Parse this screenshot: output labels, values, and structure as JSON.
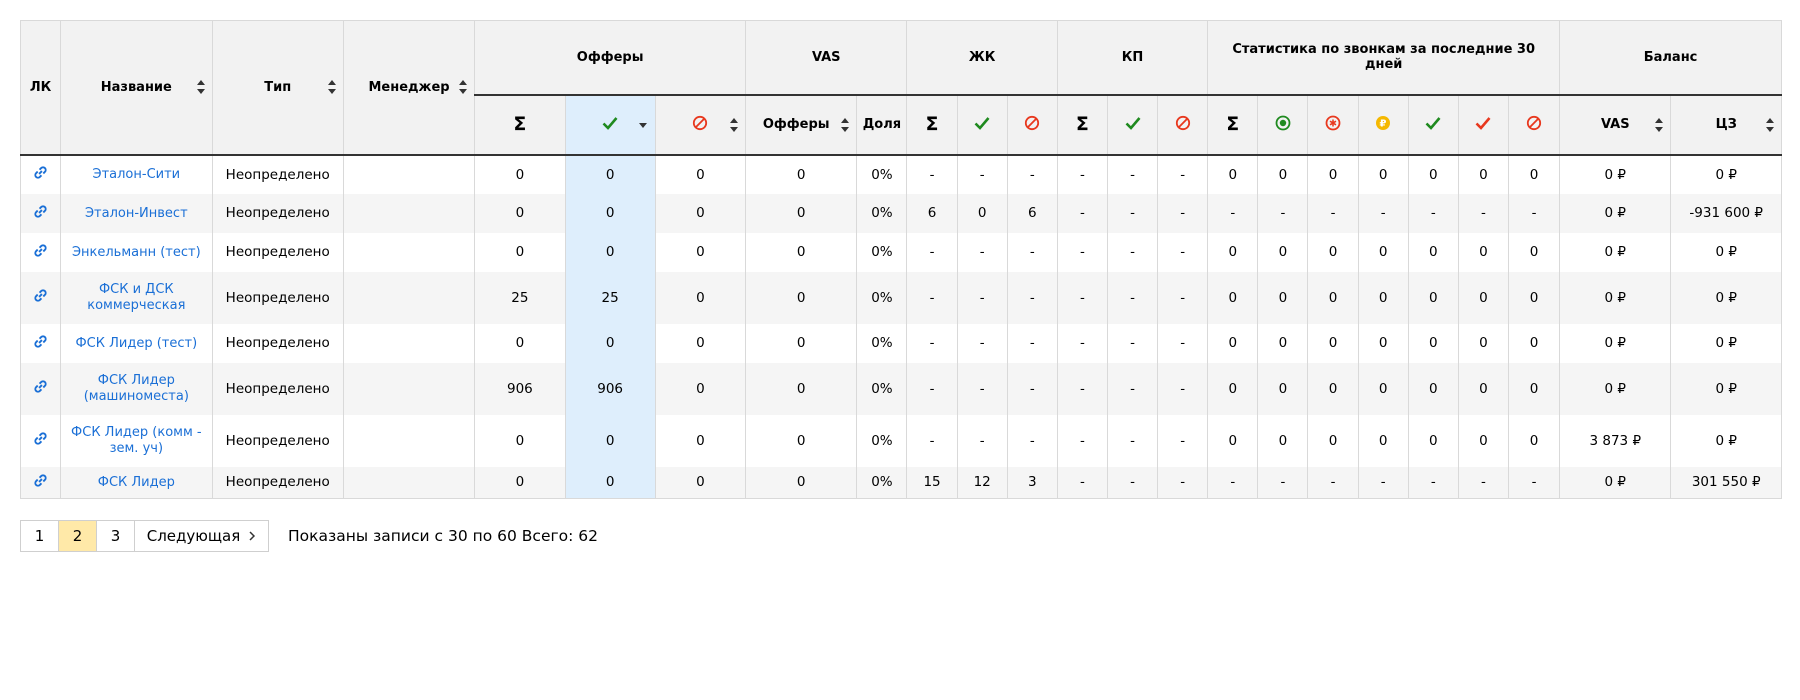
{
  "header": {
    "lk": "ЛК",
    "name": "Название",
    "type": "Тип",
    "manager": "Менеджер",
    "offers": "Офферы",
    "vas": "VAS",
    "zhk": "ЖК",
    "kp": "КП",
    "calls": "Статистика по звонкам за последние 30 дней",
    "balance": "Баланс",
    "sigma": "Σ",
    "vas_offers": "Офферы",
    "vas_share": "Доля",
    "bal_vas": "VAS",
    "bal_cz": "ЦЗ"
  },
  "colors": {
    "check": "#1f8a1f",
    "ban": "#e8381e",
    "link": "#1a6fd6",
    "selected_column": "#deeefc",
    "current_page": "#ffe9a8",
    "call_green": "#1f8a1f",
    "call_red": "#e8381e",
    "call_yellow": "#f5b800"
  },
  "icons": {
    "offers": [
      "sigma-icon",
      "check-icon",
      "ban-icon"
    ],
    "zhk": [
      "sigma-icon",
      "check-icon",
      "ban-icon"
    ],
    "kp": [
      "sigma-icon",
      "check-icon",
      "ban-icon"
    ],
    "calls": [
      "sigma-icon",
      "plus-circle-icon",
      "asterisk-circle-icon",
      "ruble-circle-icon",
      "check-icon",
      "check-red-icon",
      "ban-icon"
    ],
    "row_link": "link-icon"
  },
  "rows": [
    {
      "name": "Эталон-Сити",
      "type": "Неопределено",
      "manager": "",
      "offers": [
        "0",
        "0",
        "0"
      ],
      "vas": [
        "0",
        "0%"
      ],
      "zhk": [
        "-",
        "-",
        "-"
      ],
      "kp": [
        "-",
        "-",
        "-"
      ],
      "calls": [
        "0",
        "0",
        "0",
        "0",
        "0",
        "0",
        "0"
      ],
      "balance": [
        "0 ₽",
        "0 ₽"
      ]
    },
    {
      "name": "Эталон-Инвест",
      "type": "Неопределено",
      "manager": "",
      "offers": [
        "0",
        "0",
        "0"
      ],
      "vas": [
        "0",
        "0%"
      ],
      "zhk": [
        "6",
        "0",
        "6"
      ],
      "kp": [
        "-",
        "-",
        "-"
      ],
      "calls": [
        "-",
        "-",
        "-",
        "-",
        "-",
        "-",
        "-"
      ],
      "balance": [
        "0 ₽",
        "-931 600 ₽"
      ]
    },
    {
      "name": "Энкельманн (тест)",
      "type": "Неопределено",
      "manager": "",
      "offers": [
        "0",
        "0",
        "0"
      ],
      "vas": [
        "0",
        "0%"
      ],
      "zhk": [
        "-",
        "-",
        "-"
      ],
      "kp": [
        "-",
        "-",
        "-"
      ],
      "calls": [
        "0",
        "0",
        "0",
        "0",
        "0",
        "0",
        "0"
      ],
      "balance": [
        "0 ₽",
        "0 ₽"
      ]
    },
    {
      "name": "ФСК и ДСК коммерческая",
      "type": "Неопределено",
      "manager": "",
      "offers": [
        "25",
        "25",
        "0"
      ],
      "vas": [
        "0",
        "0%"
      ],
      "zhk": [
        "-",
        "-",
        "-"
      ],
      "kp": [
        "-",
        "-",
        "-"
      ],
      "calls": [
        "0",
        "0",
        "0",
        "0",
        "0",
        "0",
        "0"
      ],
      "balance": [
        "0 ₽",
        "0 ₽"
      ]
    },
    {
      "name": "ФСК Лидер (тест)",
      "type": "Неопределено",
      "manager": "",
      "offers": [
        "0",
        "0",
        "0"
      ],
      "vas": [
        "0",
        "0%"
      ],
      "zhk": [
        "-",
        "-",
        "-"
      ],
      "kp": [
        "-",
        "-",
        "-"
      ],
      "calls": [
        "0",
        "0",
        "0",
        "0",
        "0",
        "0",
        "0"
      ],
      "balance": [
        "0 ₽",
        "0 ₽"
      ]
    },
    {
      "name": "ФСК Лидер (машиноместа)",
      "type": "Неопределено",
      "manager": "",
      "offers": [
        "906",
        "906",
        "0"
      ],
      "vas": [
        "0",
        "0%"
      ],
      "zhk": [
        "-",
        "-",
        "-"
      ],
      "kp": [
        "-",
        "-",
        "-"
      ],
      "calls": [
        "0",
        "0",
        "0",
        "0",
        "0",
        "0",
        "0"
      ],
      "balance": [
        "0 ₽",
        "0 ₽"
      ]
    },
    {
      "name": "ФСК Лидер (комм - зем. уч)",
      "type": "Неопределено",
      "manager": "",
      "offers": [
        "0",
        "0",
        "0"
      ],
      "vas": [
        "0",
        "0%"
      ],
      "zhk": [
        "-",
        "-",
        "-"
      ],
      "kp": [
        "-",
        "-",
        "-"
      ],
      "calls": [
        "0",
        "0",
        "0",
        "0",
        "0",
        "0",
        "0"
      ],
      "balance": [
        "3 873 ₽",
        "0 ₽"
      ]
    },
    {
      "name": "ФСК Лидер",
      "type": "Неопределено",
      "manager": "",
      "offers": [
        "0",
        "0",
        "0"
      ],
      "vas": [
        "0",
        "0%"
      ],
      "zhk": [
        "15",
        "12",
        "3"
      ],
      "kp": [
        "-",
        "-",
        "-"
      ],
      "calls": [
        "-",
        "-",
        "-",
        "-",
        "-",
        "-",
        "-"
      ],
      "balance": [
        "0 ₽",
        "301 550 ₽"
      ]
    }
  ],
  "pagination": {
    "pages": [
      "1",
      "2",
      "3"
    ],
    "current": "2",
    "next_label": "Следующая",
    "info": "Показаны записи с 30 по 60 Всего: 62"
  }
}
